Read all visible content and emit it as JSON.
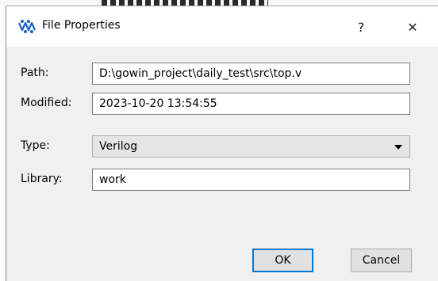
{
  "window": {
    "title": "File Properties",
    "app_icon": "gowin-logo-icon",
    "help_label": "?",
    "close_label": "✕"
  },
  "form": {
    "path_label": "Path:",
    "path_value": "D:\\gowin_project\\daily_test\\src\\top.v",
    "modified_label": "Modified:",
    "modified_value": "2023-10-20 13:54:55",
    "type_label": "Type:",
    "type_value": "Verilog",
    "library_label": "Library:",
    "library_value": "work"
  },
  "buttons": {
    "ok_label": "OK",
    "cancel_label": "Cancel"
  },
  "colors": {
    "accent": "#0078d7",
    "icon": "#1e5fbf"
  }
}
